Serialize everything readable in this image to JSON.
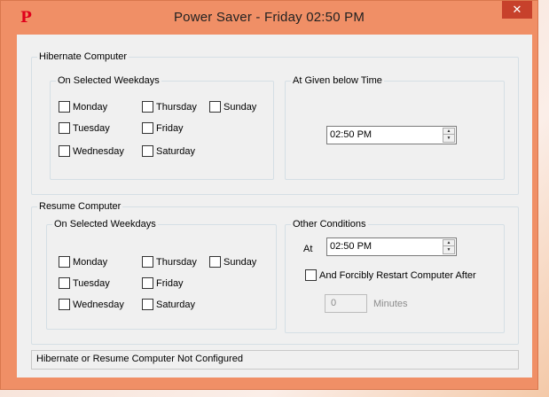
{
  "window": {
    "title": "Power Saver - Friday 02:50 PM",
    "app_icon": "P",
    "close_glyph": "✕"
  },
  "hibernate": {
    "group_title": "Hibernate Computer",
    "weekdays": {
      "title": "On Selected Weekdays",
      "days": [
        "Monday",
        "Tuesday",
        "Wednesday",
        "Thursday",
        "Friday",
        "Saturday",
        "Sunday"
      ]
    },
    "time": {
      "title": "At Given below Time",
      "value": "02:50 PM"
    }
  },
  "resume": {
    "group_title": "Resume Computer",
    "weekdays": {
      "title": "On Selected Weekdays",
      "days": [
        "Monday",
        "Tuesday",
        "Wednesday",
        "Thursday",
        "Friday",
        "Saturday",
        "Sunday"
      ]
    },
    "conditions": {
      "title": "Other Conditions",
      "at_label": "At",
      "time_value": "02:50 PM",
      "restart_label": "And Forcibly Restart Computer After",
      "minutes_value": "0",
      "minutes_label": "Minutes"
    }
  },
  "status": {
    "text": "Hibernate or Resume Computer Not Configured"
  }
}
